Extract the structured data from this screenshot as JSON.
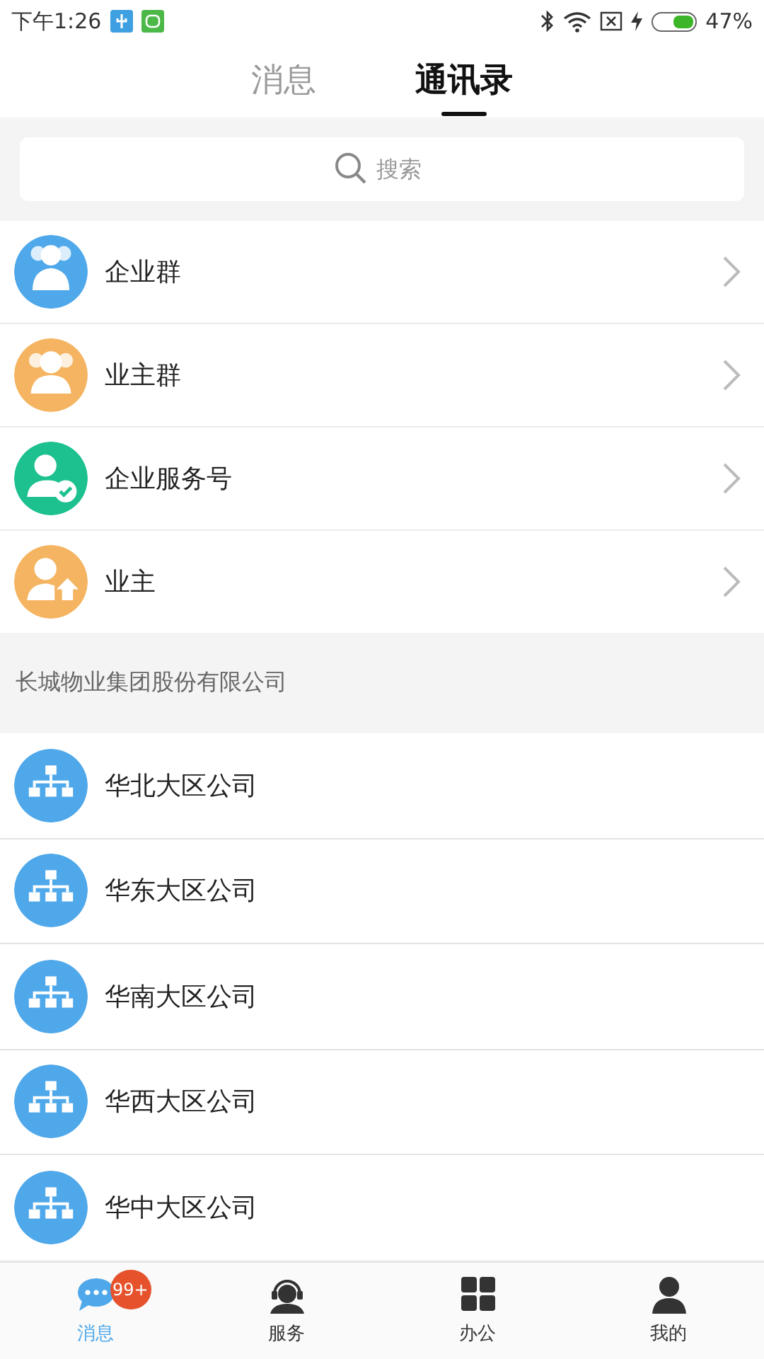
{
  "status_bar": {
    "time": "下午1:26",
    "battery": "47%"
  },
  "tabs": [
    {
      "label": "消息",
      "selected": false
    },
    {
      "label": "通讯录",
      "selected": true
    }
  ],
  "search": {
    "placeholder": "搜索"
  },
  "groups": [
    {
      "kind": "company",
      "label": "企业群"
    },
    {
      "kind": "owners",
      "label": "业主群"
    },
    {
      "kind": "service",
      "label": "企业服务号"
    },
    {
      "kind": "owner",
      "label": "业主"
    }
  ],
  "section_title": "长城物业集团股份有限公司",
  "departments": [
    {
      "label": "华北大区公司"
    },
    {
      "label": "华东大区公司"
    },
    {
      "label": "华南大区公司"
    },
    {
      "label": "华西大区公司"
    },
    {
      "label": "华中大区公司"
    }
  ],
  "bottom_nav": [
    {
      "kind": "chat",
      "label": "消息",
      "selected": true,
      "badge": "99+"
    },
    {
      "kind": "service",
      "label": "服务",
      "selected": false
    },
    {
      "kind": "office",
      "label": "办公",
      "selected": false
    },
    {
      "kind": "me",
      "label": "我的",
      "selected": false
    }
  ]
}
